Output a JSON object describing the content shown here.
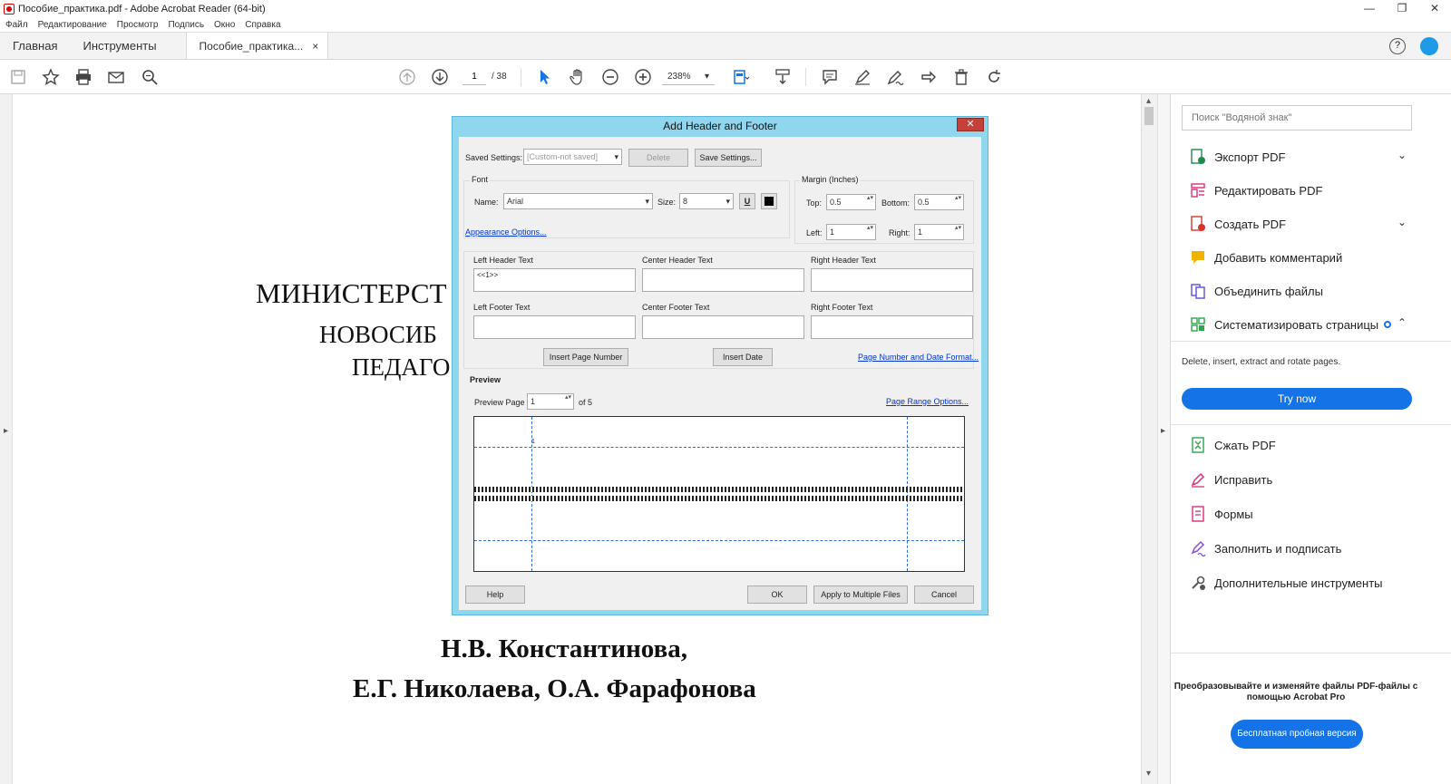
{
  "window": {
    "title": "Пособие_практика.pdf - Adobe Acrobat Reader (64-bit)",
    "minimize": "—",
    "restore": "❐",
    "close": "✕"
  },
  "menu": [
    "Файл",
    "Редактирование",
    "Просмотр",
    "Подпись",
    "Окно",
    "Справка"
  ],
  "tabs": {
    "home": "Главная",
    "tools": "Инструменты",
    "document": "Пособие_практика...",
    "close": "×",
    "help": "?"
  },
  "toolbar": {
    "page_current": "1",
    "page_total": "/ 38",
    "zoom": "238%",
    "zoom_arrow": "▾"
  },
  "document": {
    "line1": "МИНИСТЕРСТ",
    "line2": "НОВОСИБ",
    "line3": "ПЕДАГО",
    "authors_line1": "Н.В. Константинова,",
    "authors_line2": "Е.Г. Николаева, О.А. Фарафонова"
  },
  "dialog": {
    "title": "Add Header and Footer",
    "close": "✕",
    "saved_settings_label": "Saved Settings:",
    "saved_settings_value": "[Custom-not saved]",
    "delete_button": "Delete",
    "save_settings_button": "Save Settings...",
    "font_group": "Font",
    "font_name_label": "Name:",
    "font_name_value": "Arial",
    "font_size_label": "Size:",
    "font_size_value": "8",
    "underline_glyph": "U",
    "appearance_link": "Appearance Options...",
    "margin_group": "Margin (Inches)",
    "top_label": "Top:",
    "top_value": "0.5",
    "bottom_label": "Bottom:",
    "bottom_value": "0.5",
    "left_label": "Left:",
    "left_value": "1",
    "right_label": "Right:",
    "right_value": "1",
    "left_header_label": "Left Header Text",
    "left_header_value": "<<1>>",
    "center_header_label": "Center Header Text",
    "right_header_label": "Right Header Text",
    "left_footer_label": "Left Footer Text",
    "center_footer_label": "Center Footer Text",
    "right_footer_label": "Right Footer Text",
    "insert_page_number": "Insert Page Number",
    "insert_date": "Insert Date",
    "page_number_format_link": "Page Number and Date Format...",
    "preview_label": "Preview",
    "preview_page_label": "Preview Page",
    "preview_page_value": "1",
    "preview_of": "of 5",
    "page_range_link": "Page Range Options...",
    "preview_header_mark": "1",
    "help_button": "Help",
    "ok_button": "OK",
    "apply_multiple_button": "Apply to Multiple Files",
    "cancel_button": "Cancel"
  },
  "right_panel": {
    "search_placeholder": "Поиск \"Водяной знак\"",
    "items": [
      {
        "label": "Экспорт PDF",
        "color": "#1e8a4c"
      },
      {
        "label": "Редактировать PDF",
        "color": "#d9317a"
      },
      {
        "label": "Создать PDF",
        "color": "#d8352a"
      },
      {
        "label": "Добавить комментарий",
        "color": "#f0b300"
      },
      {
        "label": "Объединить файлы",
        "color": "#5b4fd6"
      },
      {
        "label": "Систематизировать страницы",
        "color": "#2ba64b"
      }
    ],
    "description": "Delete, insert, extract and rotate pages.",
    "try_now": "Try now",
    "items2": [
      {
        "label": "Сжать PDF",
        "color": "#2ba64b"
      },
      {
        "label": "Исправить",
        "color": "#d9317a"
      },
      {
        "label": "Формы",
        "color": "#d9317a"
      },
      {
        "label": "Заполнить и подписать",
        "color": "#8a4fd6"
      },
      {
        "label": "Дополнительные инструменты",
        "color": "#555555"
      }
    ],
    "promo_text": "Преобразовывайте и изменяйте файлы PDF-файлы с помощью Acrobat Pro",
    "promo_button": "Бесплатная пробная версия",
    "chevron_down": "⌄",
    "chevron_up": "⌃"
  }
}
